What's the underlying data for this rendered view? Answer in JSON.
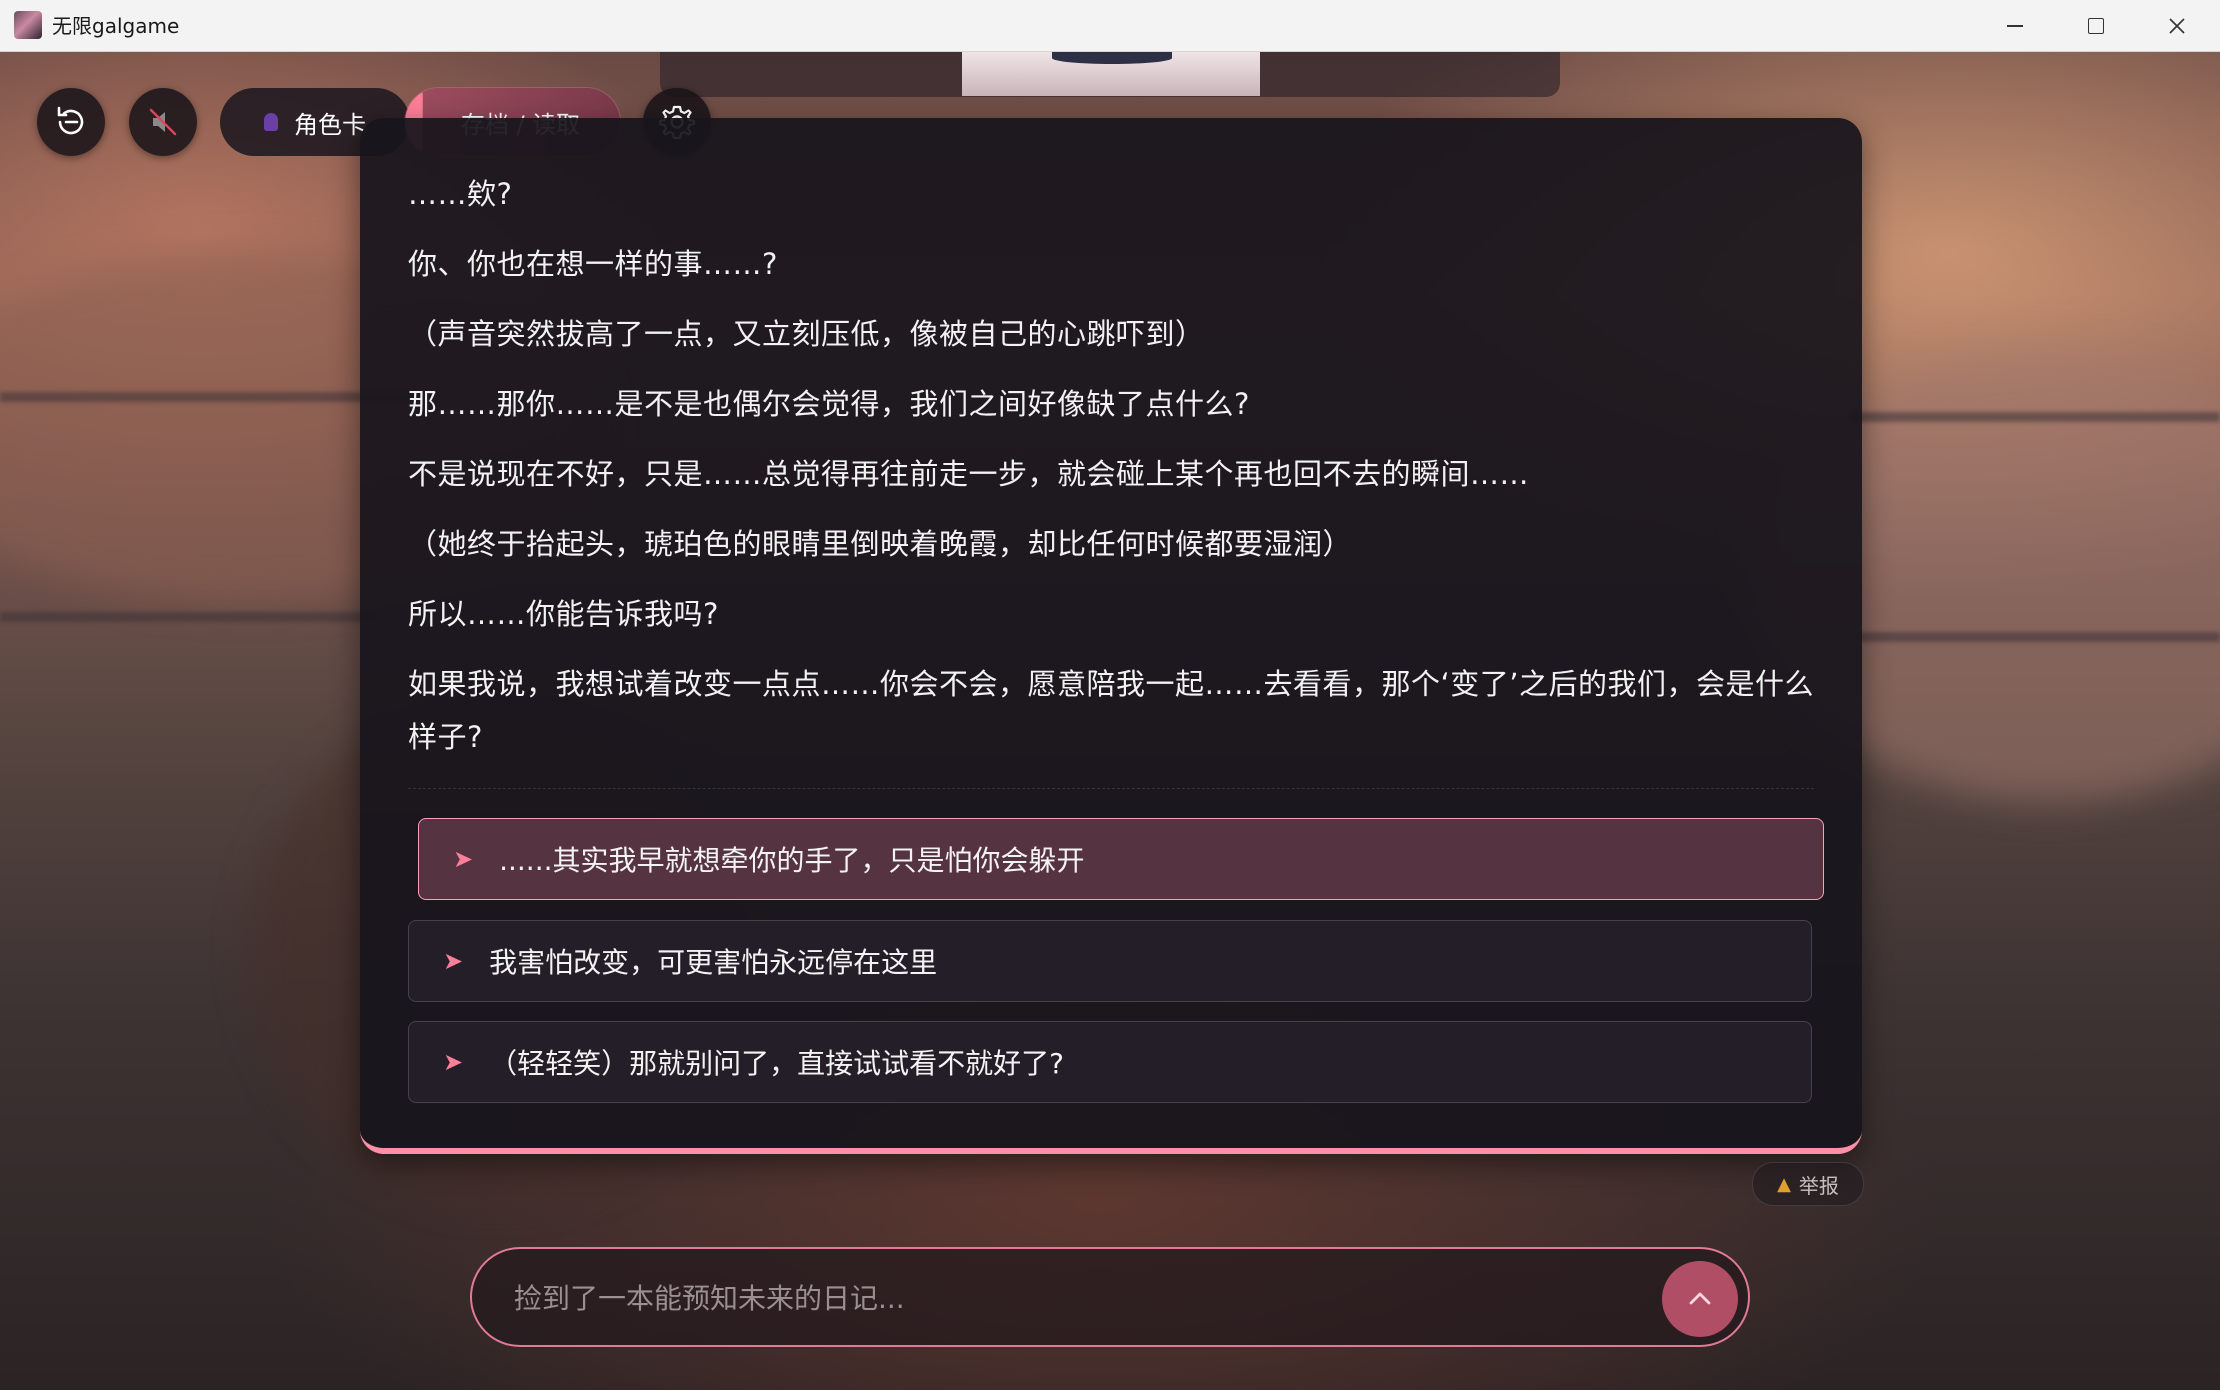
{
  "window": {
    "title": "无限galgame"
  },
  "toolbar": {
    "restart_icon": "restart-icon",
    "mute_icon": "mute-icon",
    "character_card_label": "角色卡",
    "save_load_label": "存档 / 读取",
    "settings_icon": "gear-icon"
  },
  "dialog": {
    "lines": [
      "……欸?",
      "你、你也在想一样的事……?",
      "（声音突然拔高了一点，又立刻压低，像被自己的心跳吓到）",
      "那……那你……是不是也偶尔会觉得，我们之间好像缺了点什么?",
      "不是说现在不好，只是……总觉得再往前走一步，就会碰上某个再也回不去的瞬间……",
      "（她终于抬起头，琥珀色的眼睛里倒映着晚霞，却比任何时候都要湿润）",
      "所以……你能告诉我吗?",
      "如果我说，我想试着改变一点点……你会不会，愿意陪我一起……去看看，那个‘变了’之后的我们，会是什么样子?"
    ],
    "choices": [
      {
        "label": "......其实我早就想牵你的手了，只是怕你会躲开",
        "selected": true
      },
      {
        "label": "我害怕改变，可更害怕永远停在这里",
        "selected": false
      },
      {
        "label": "（轻轻笑）那就别问了，直接试试看不就好了?",
        "selected": false
      }
    ],
    "accent_color": "#ff8fa8"
  },
  "report": {
    "label": "举报"
  },
  "input": {
    "placeholder": "捡到了一本能预知未来的日记...",
    "value": ""
  }
}
